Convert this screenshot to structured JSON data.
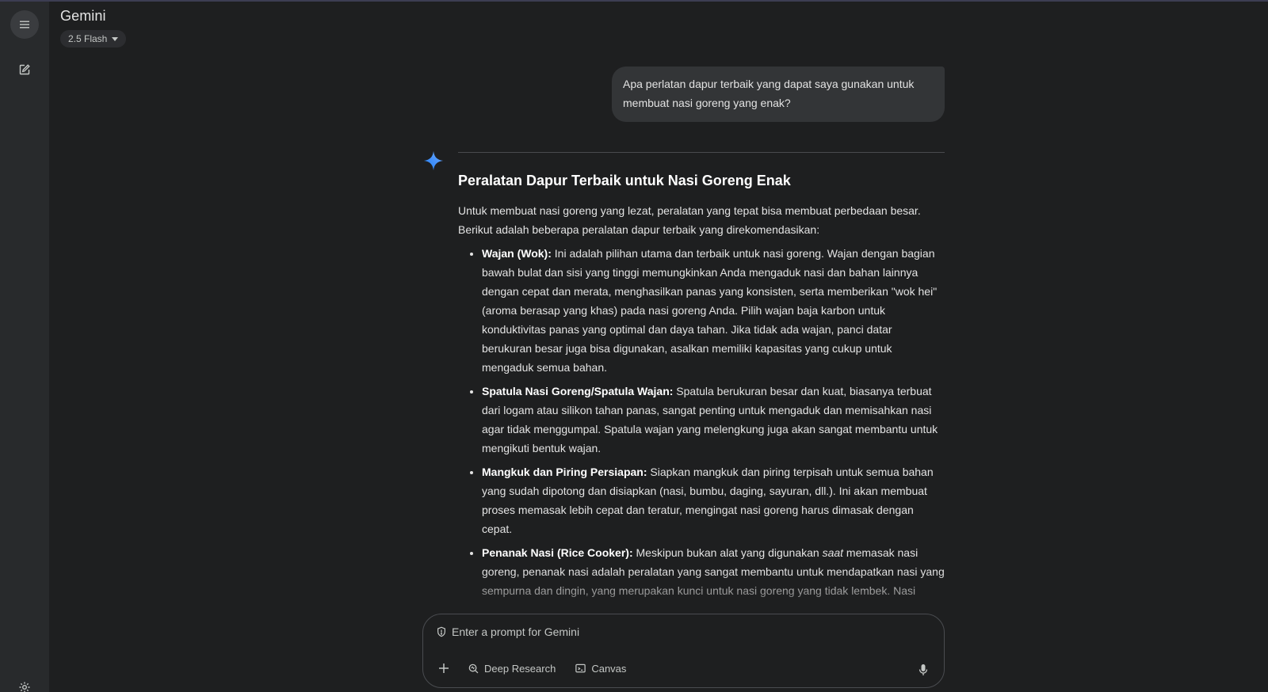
{
  "app": {
    "title": "Gemini",
    "model": "2.5 Flash"
  },
  "sidebar": {
    "menu_icon": "menu-icon",
    "new_chat_icon": "edit-icon",
    "settings_icon": "gear-icon"
  },
  "conversation": {
    "user_message": "Apa perlatan dapur terbaik yang dapat saya gunakan untuk membuat nasi goreng yang enak?",
    "response": {
      "heading": "Peralatan Dapur Terbaik untuk Nasi Goreng Enak",
      "intro": "Untuk membuat nasi goreng yang lezat, peralatan yang tepat bisa membuat perbedaan besar. Berikut adalah beberapa peralatan dapur terbaik yang direkomendasikan:",
      "items": [
        {
          "title": "Wajan (Wok):",
          "text": " Ini adalah pilihan utama dan terbaik untuk nasi goreng. Wajan dengan bagian bawah bulat dan sisi yang tinggi memungkinkan Anda mengaduk nasi dan bahan lainnya dengan cepat dan merata, menghasilkan panas yang konsisten, serta memberikan \"wok hei\" (aroma berasap yang khas) pada nasi goreng Anda. Pilih wajan baja karbon untuk konduktivitas panas yang optimal dan daya tahan. Jika tidak ada wajan, panci datar berukuran besar juga bisa digunakan, asalkan memiliki kapasitas yang cukup untuk mengaduk semua bahan."
        },
        {
          "title": "Spatula Nasi Goreng/Spatula Wajan:",
          "text": " Spatula berukuran besar dan kuat, biasanya terbuat dari logam atau silikon tahan panas, sangat penting untuk mengaduk dan memisahkan nasi agar tidak menggumpal. Spatula wajan yang melengkung juga akan sangat membantu untuk mengikuti bentuk wajan."
        },
        {
          "title": "Mangkuk dan Piring Persiapan:",
          "text": " Siapkan mangkuk dan piring terpisah untuk semua bahan yang sudah dipotong dan disiapkan (nasi, bumbu, daging, sayuran, dll.). Ini akan membuat proses memasak lebih cepat dan teratur, mengingat nasi goreng harus dimasak dengan cepat."
        },
        {
          "title": "Penanak Nasi (Rice Cooker):",
          "text_before_em": " Meskipun bukan alat yang digunakan ",
          "em": "saat",
          "text": " memasak nasi goreng, penanak nasi adalah peralatan yang sangat membantu untuk mendapatkan nasi yang sempurna dan dingin, yang merupakan kunci untuk nasi goreng yang tidak lembek. Nasi"
        }
      ]
    }
  },
  "prompt": {
    "placeholder": "Enter a prompt for Gemini",
    "tools": {
      "add_icon": "plus-icon",
      "deep_research": "Deep Research",
      "canvas": "Canvas",
      "mic_icon": "mic-icon"
    }
  },
  "colors": {
    "background": "#1e1f20",
    "sidebar": "#282a2c",
    "user_bubble": "#333537",
    "accent": "#4285f4"
  }
}
